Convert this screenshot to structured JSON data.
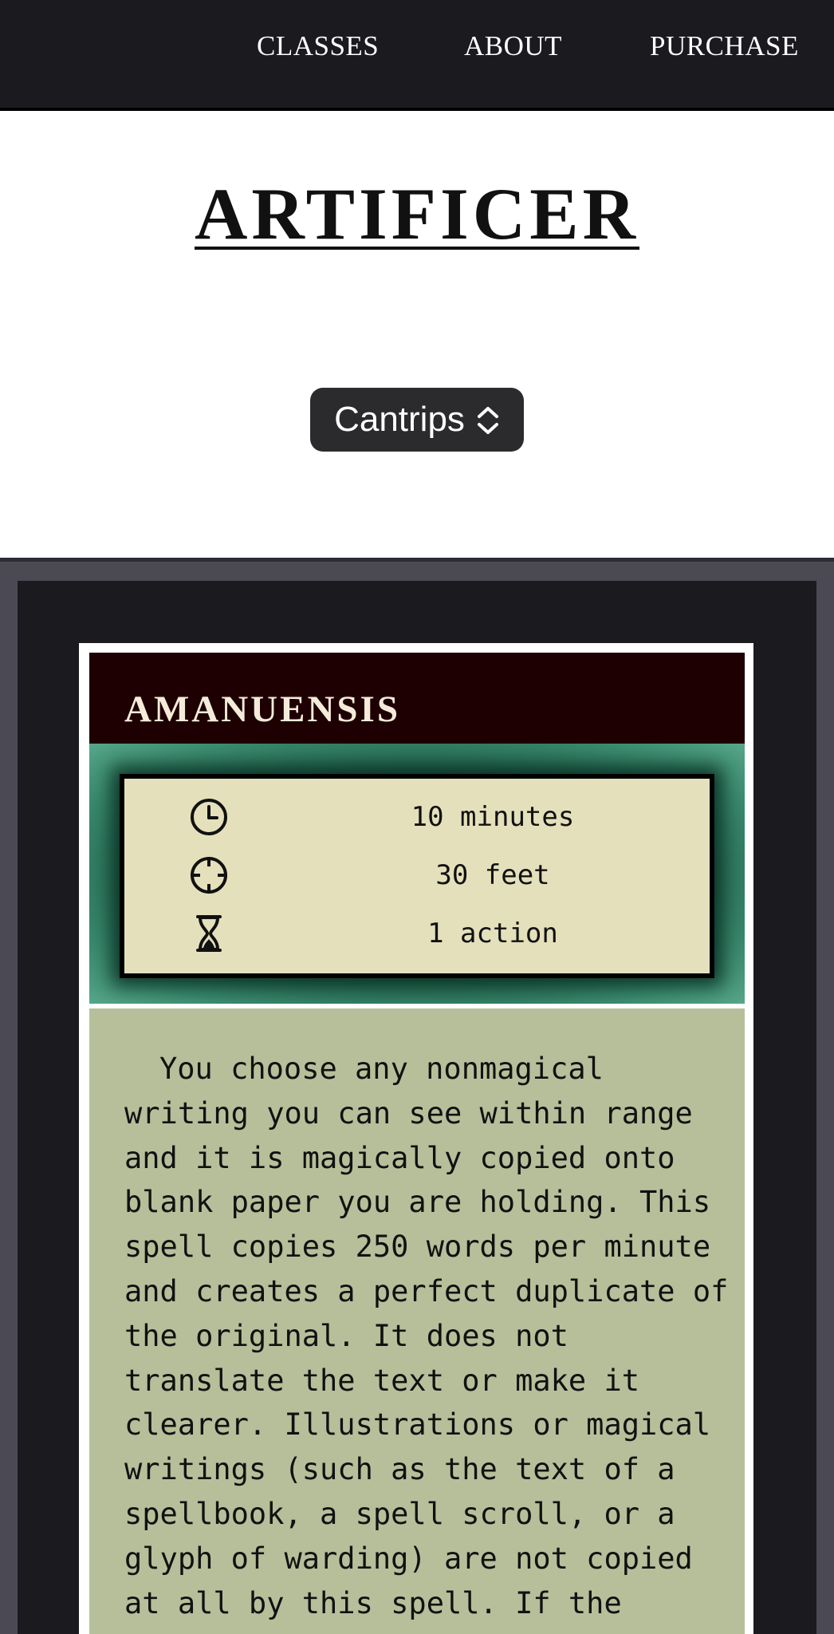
{
  "nav": {
    "items": [
      {
        "label": "CLASSES"
      },
      {
        "label": "ABOUT"
      },
      {
        "label": "PURCHASE"
      }
    ]
  },
  "page": {
    "title": "ARTIFICER"
  },
  "spell_level_select": {
    "value": "Cantrips",
    "icon": "chevron-up-down-icon"
  },
  "spell_card": {
    "name": "AMANUENSIS",
    "stats": [
      {
        "icon": "clock-icon",
        "label": "duration",
        "value": "10 minutes"
      },
      {
        "icon": "crosshair-icon",
        "label": "range",
        "value": "30 feet"
      },
      {
        "icon": "hourglass-icon",
        "label": "casting-time",
        "value": "1 action"
      }
    ],
    "description": "You choose any nonmagical writing you can see within range and it is magically copied onto blank paper you are holding. This spell copies 250 words per minute and creates a perfect duplicate of the original. It does not translate the text or make it clearer. Illustrations or magical writings (such as the text of a spellbook, a spell scroll, or a glyph of warding) are not copied at all by this spell. If the"
  },
  "colors": {
    "topbar": "#1b1a1f",
    "card_header": "#1e0003",
    "stats_box": "#e4e0bb",
    "glow": "#1c5b45",
    "description_panel": "#b6bf9a",
    "frame": "#4b4a54"
  }
}
